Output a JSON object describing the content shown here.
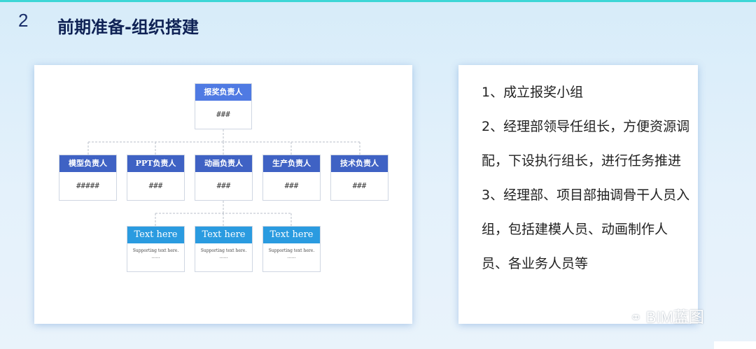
{
  "slide": {
    "number": "2",
    "title": "前期准备-组织搭建"
  },
  "org_chart": {
    "top": {
      "title": "报奖负责人",
      "value": "###"
    },
    "middle": [
      {
        "title": "模型负责人",
        "value": "#####"
      },
      {
        "title": "PPT负责人",
        "value": "###"
      },
      {
        "title": "动画负责人",
        "value": "###"
      },
      {
        "title": "生产负责人",
        "value": "###"
      },
      {
        "title": "技术负责人",
        "value": "###"
      }
    ],
    "bottom": [
      {
        "title": "Text here",
        "line1": "Supporting text here.",
        "line2": "……"
      },
      {
        "title": "Text here",
        "line1": "Supporting text here.",
        "line2": "……"
      },
      {
        "title": "Text here",
        "line1": "Supporting text here.",
        "line2": "……"
      }
    ]
  },
  "notes": {
    "items": [
      "1、成立报奖小组",
      "2、经理部领导任组长，方便资源调配，下设执行组长，进行任务推进",
      "3、经理部、项目部抽调骨干人员入组，包括建模人员、动画制作人员、各业务人员等"
    ]
  },
  "watermark": {
    "text": "BIM蓝图"
  },
  "colors": {
    "top_header": "#4f7ae3",
    "mid_header": "#3f62c4",
    "low_header": "#2a9be0",
    "title": "#0f2255"
  }
}
